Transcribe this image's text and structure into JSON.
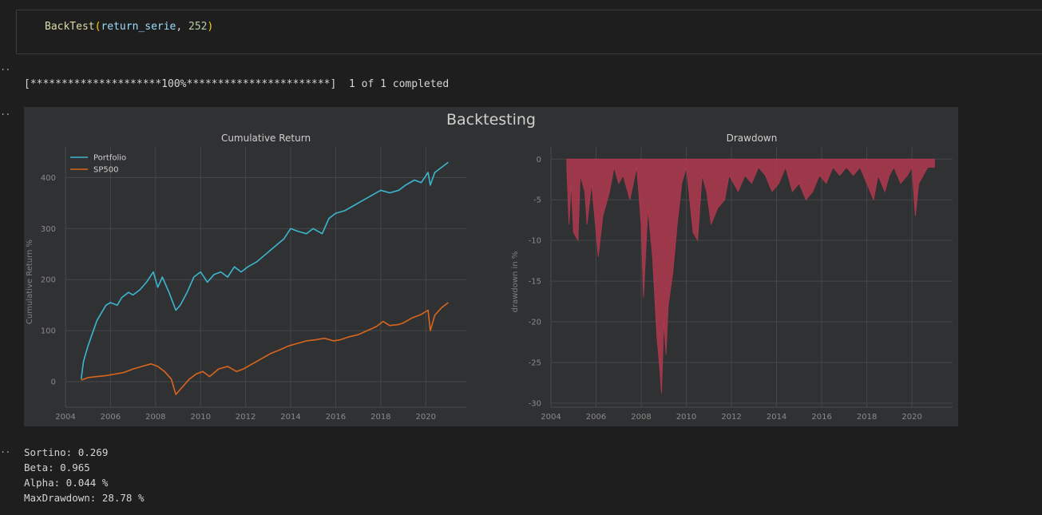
{
  "code_cell": {
    "fn": "BackTest",
    "open": "(",
    "arg1": "return_serie",
    "sep": ", ",
    "arg2": "252",
    "close": ")"
  },
  "output": {
    "progress_text": "[*********************100%***********************]  1 of 1 completed",
    "stats": [
      "Sortino: 0.269",
      "Beta: 0.965",
      "Alpha: 0.044 %",
      "MaxDrawdown: 28.78 %"
    ]
  },
  "gutter_marker": "..",
  "chart_data": {
    "suptitle": "Backtesting",
    "charts": [
      {
        "type": "line",
        "title": "Cumulative Return",
        "xlabel": "",
        "ylabel": "Cumulative Return %",
        "xlim": [
          2004,
          2021.8
        ],
        "ylim": [
          -50,
          460
        ],
        "xticks": [
          2004,
          2006,
          2008,
          2010,
          2012,
          2014,
          2016,
          2018,
          2020
        ],
        "yticks": [
          0,
          100,
          200,
          300,
          400
        ],
        "grid": true,
        "legend": "top-left",
        "series": [
          {
            "name": "Portfolio",
            "color": "#3cb6cf",
            "x": [
              2004.7,
              2004.8,
              2005.0,
              2005.2,
              2005.4,
              2005.6,
              2005.8,
              2006.0,
              2006.3,
              2006.5,
              2006.8,
              2007.0,
              2007.3,
              2007.6,
              2007.9,
              2008.1,
              2008.3,
              2008.6,
              2008.9,
              2009.1,
              2009.4,
              2009.7,
              2010.0,
              2010.3,
              2010.6,
              2010.9,
              2011.2,
              2011.5,
              2011.8,
              2012.1,
              2012.5,
              2012.9,
              2013.3,
              2013.7,
              2014.0,
              2014.3,
              2014.7,
              2015.0,
              2015.4,
              2015.7,
              2016.0,
              2016.4,
              2016.8,
              2017.2,
              2017.6,
              2018.0,
              2018.4,
              2018.8,
              2019.1,
              2019.5,
              2019.8,
              2020.1,
              2020.2,
              2020.4,
              2020.7,
              2021.0
            ],
            "values": [
              5,
              40,
              70,
              95,
              120,
              135,
              150,
              155,
              150,
              165,
              175,
              170,
              180,
              195,
              215,
              185,
              205,
              175,
              140,
              150,
              175,
              205,
              215,
              195,
              210,
              215,
              205,
              225,
              215,
              225,
              235,
              250,
              265,
              280,
              300,
              295,
              290,
              300,
              290,
              320,
              330,
              335,
              345,
              355,
              365,
              375,
              370,
              375,
              385,
              395,
              390,
              410,
              385,
              410,
              420,
              430
            ]
          },
          {
            "name": "SP500",
            "color": "#d9661c",
            "x": [
              2004.7,
              2005.0,
              2005.4,
              2005.8,
              2006.2,
              2006.6,
              2007.0,
              2007.4,
              2007.8,
              2008.1,
              2008.4,
              2008.7,
              2008.9,
              2009.2,
              2009.5,
              2009.8,
              2010.1,
              2010.4,
              2010.8,
              2011.2,
              2011.6,
              2011.9,
              2012.3,
              2012.7,
              2013.1,
              2013.5,
              2013.9,
              2014.3,
              2014.7,
              2015.1,
              2015.5,
              2015.9,
              2016.2,
              2016.6,
              2017.0,
              2017.4,
              2017.8,
              2018.1,
              2018.4,
              2018.8,
              2019.0,
              2019.4,
              2019.8,
              2020.1,
              2020.2,
              2020.4,
              2020.7,
              2021.0
            ],
            "values": [
              3,
              8,
              10,
              12,
              15,
              18,
              25,
              30,
              35,
              30,
              20,
              5,
              -25,
              -10,
              5,
              15,
              20,
              10,
              25,
              30,
              20,
              25,
              35,
              45,
              55,
              62,
              70,
              75,
              80,
              82,
              85,
              80,
              82,
              88,
              92,
              100,
              108,
              118,
              110,
              112,
              115,
              125,
              132,
              140,
              100,
              130,
              145,
              155
            ]
          }
        ]
      },
      {
        "type": "area",
        "title": "Drawdown",
        "xlabel": "",
        "ylabel": "drawdown in %",
        "xlim": [
          2004,
          2021.8
        ],
        "ylim": [
          -30.5,
          1.5
        ],
        "xticks": [
          2004,
          2006,
          2008,
          2010,
          2012,
          2014,
          2016,
          2018,
          2020
        ],
        "yticks": [
          0,
          -5,
          -10,
          -15,
          -20,
          -25,
          -30
        ],
        "grid": true,
        "color": "#b0384f",
        "x": [
          2004.7,
          2004.8,
          2004.9,
          2005.0,
          2005.2,
          2005.3,
          2005.5,
          2005.6,
          2005.8,
          2005.9,
          2006.1,
          2006.3,
          2006.6,
          2006.8,
          2007.0,
          2007.2,
          2007.5,
          2007.8,
          2008.0,
          2008.1,
          2008.3,
          2008.5,
          2008.7,
          2008.8,
          2008.9,
          2009.0,
          2009.1,
          2009.2,
          2009.4,
          2009.6,
          2009.8,
          2010.0,
          2010.3,
          2010.5,
          2010.7,
          2010.9,
          2011.1,
          2011.4,
          2011.7,
          2011.9,
          2012.3,
          2012.6,
          2012.9,
          2013.2,
          2013.5,
          2013.8,
          2014.1,
          2014.4,
          2014.7,
          2015.0,
          2015.3,
          2015.6,
          2015.9,
          2016.2,
          2016.5,
          2016.8,
          2017.1,
          2017.4,
          2017.7,
          2018.0,
          2018.3,
          2018.5,
          2018.8,
          2019.0,
          2019.2,
          2019.5,
          2019.8,
          2020.0,
          2020.15,
          2020.3,
          2020.5,
          2020.7,
          2021.0
        ],
        "values": [
          -1,
          -8,
          -3,
          -9,
          -10,
          -2,
          -4,
          -8,
          -3,
          -6,
          -12,
          -7,
          -4,
          -1,
          -3,
          -2,
          -5,
          -1,
          -8,
          -17,
          -6,
          -12,
          -22,
          -25,
          -28.8,
          -20,
          -24,
          -18,
          -14,
          -8,
          -3,
          -1,
          -9,
          -10,
          -2,
          -4,
          -8,
          -6,
          -5,
          -2,
          -4,
          -2,
          -3,
          -1,
          -2,
          -4,
          -3,
          -1,
          -4,
          -3,
          -5,
          -4,
          -2,
          -3,
          -1,
          -2,
          -1,
          -2,
          -1,
          -3,
          -5,
          -2,
          -4,
          -2,
          -1,
          -3,
          -2,
          -1,
          -7,
          -3,
          -2,
          -1,
          -1
        ]
      }
    ]
  }
}
